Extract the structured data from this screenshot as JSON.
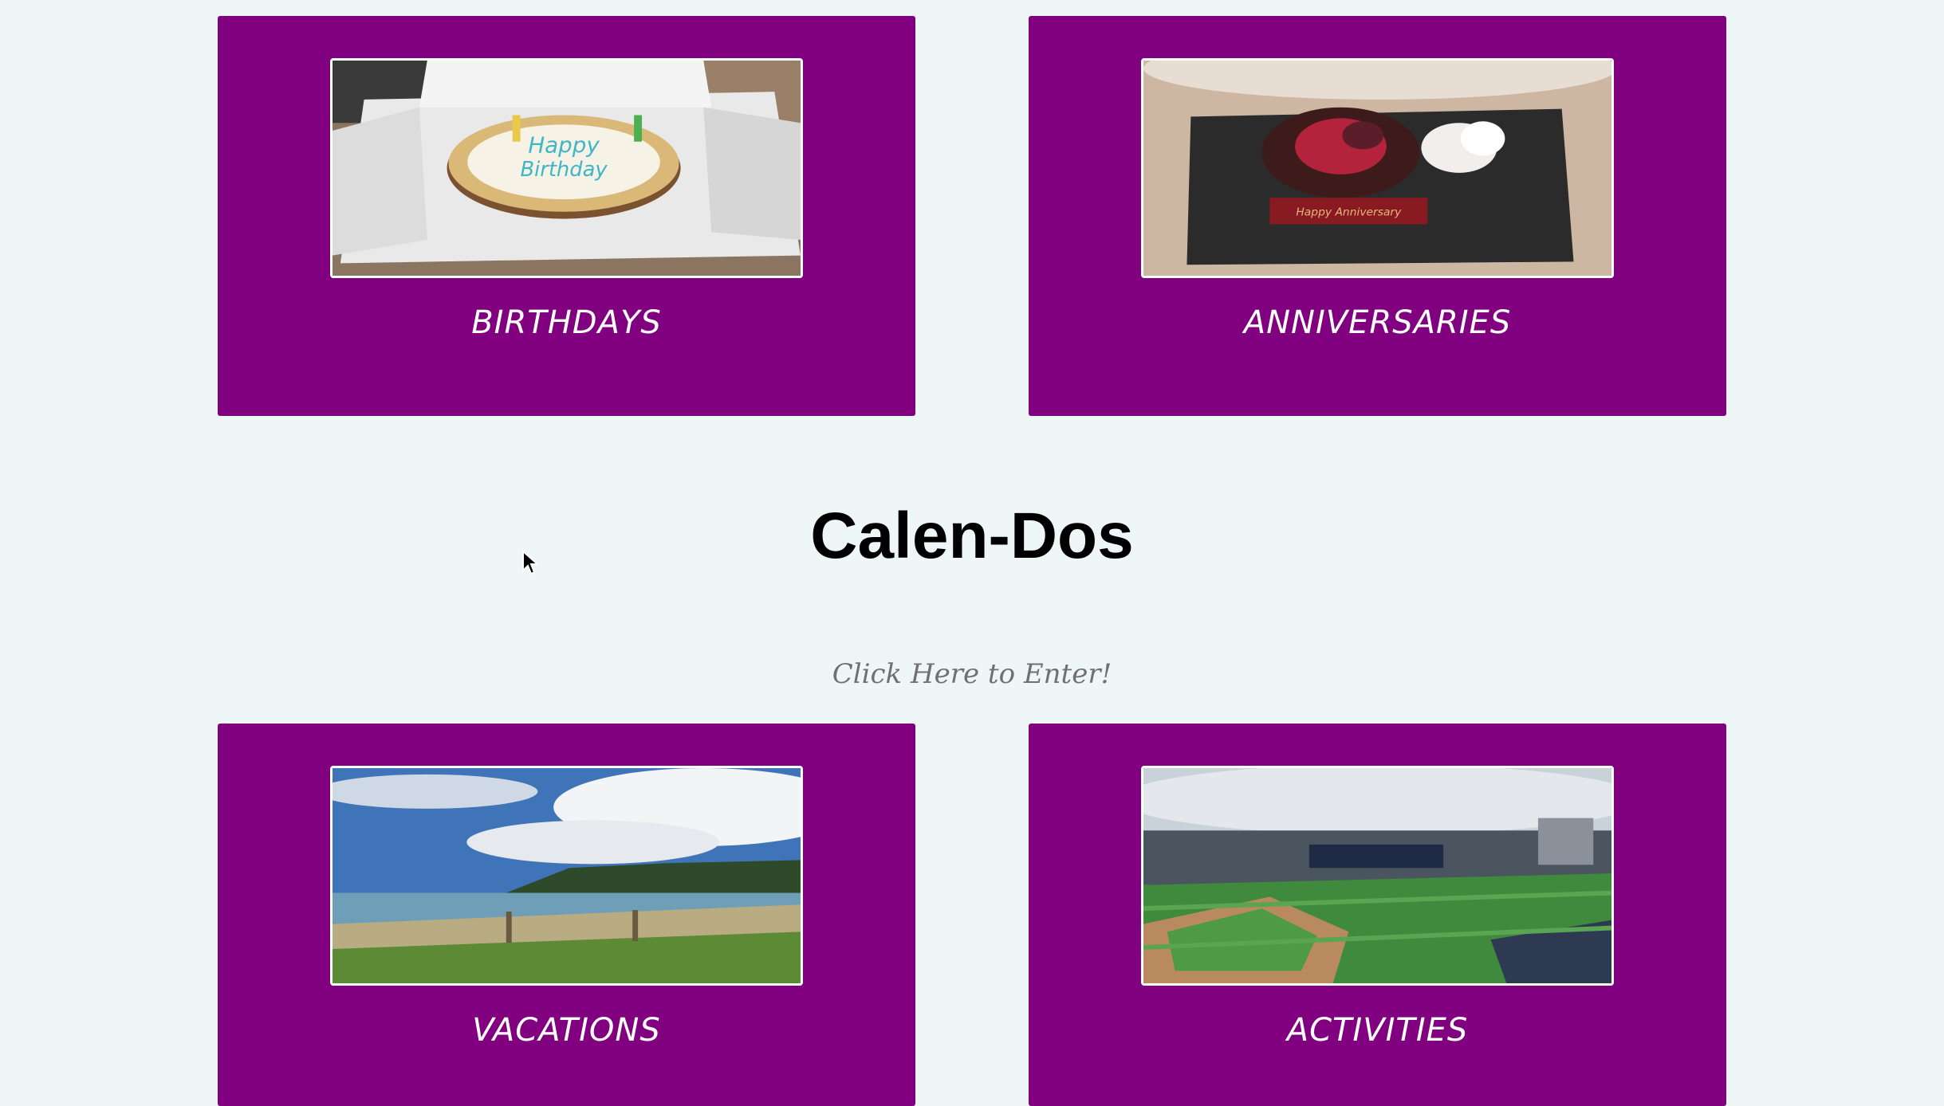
{
  "page": {
    "title": "Calen-Dos",
    "enter_link": "Click Here to Enter!"
  },
  "cards": [
    {
      "label": "BIRTHDAYS",
      "photo": "birthday-cake-photo"
    },
    {
      "label": "ANNIVERSARIES",
      "photo": "anniversary-dessert-photo"
    },
    {
      "label": "VACATIONS",
      "photo": "beach-photo"
    },
    {
      "label": "ACTIVITIES",
      "photo": "baseball-stadium-photo"
    }
  ],
  "colors": {
    "background": "#eff6f8",
    "card": "#800080",
    "card_text": "#ffffff",
    "title": "#000000",
    "link": "#707070"
  }
}
